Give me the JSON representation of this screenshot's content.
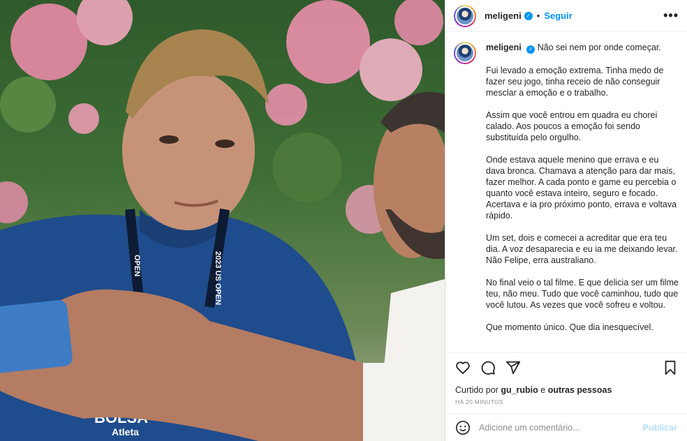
{
  "post": {
    "username": "meligeni",
    "follow_label": "Seguir",
    "dot": "•",
    "more_icon": "more-options-icon"
  },
  "caption": {
    "username": "meligeni",
    "first_line": "Não sei nem por onde começar.",
    "paragraphs": [
      "Fui levado a emoção extrema. Tinha medo de fazer seu jogo, tinha receio de não conseguir mesclar a emoção e o trabalho.",
      "Assim que você entrou em quadra eu chorei calado. Aos poucos a emoção foi sendo substituída pelo orgulho.",
      "Onde estava aquele menino que errava e eu dava bronca. Chamava a atenção para dar mais, fazer melhor. A cada ponto e game eu percebia o quanto você estava inteiro, seguro e focado. Acertava e ia pro próximo ponto, errava e voltava rápido.",
      "Um set, dois e comecei a acreditar que era teu dia. A voz desaparecia e eu ia me deixando levar. Não Felipe, erra australiano.",
      "No final veio o tal filme. E que delicia ser um filme teu, não meu. Tudo que você caminhou, tudo que você lutou. As vezes que você sofreu e voltou.",
      "Que momento único. Que dia inesquecível."
    ]
  },
  "likes": {
    "prefix": "Curtido por ",
    "user": "gu_rubio",
    "middle": " e ",
    "others": "outras pessoas"
  },
  "timestamp": "HÁ 20 MINUTOS",
  "comment": {
    "placeholder": "Adicione um comentário...",
    "publish_label": "Publicar"
  },
  "photo": {
    "lanyard_text": "2023 US OPEN",
    "shirt_text_1": "BOLSA",
    "shirt_text_2": "Atleta"
  },
  "colors": {
    "link": "#0095f6",
    "publish_disabled": "#b2dffc",
    "muted": "#8e8e8e"
  }
}
